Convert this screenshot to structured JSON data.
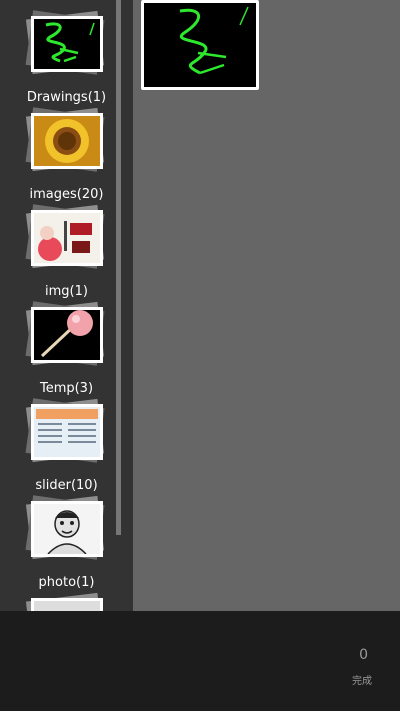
{
  "albums": [
    {
      "label": "Drawings(1)",
      "icon": "green-scribble-thumb"
    },
    {
      "label": "images(20)",
      "icon": "sunflower-thumb"
    },
    {
      "label": "img(1)",
      "icon": "zhou-nian-poster-thumb"
    },
    {
      "label": "Temp(3)",
      "icon": "lollipop-thumb"
    },
    {
      "label": "slider(10)",
      "icon": "document-thumb"
    },
    {
      "label": "photo(1)",
      "icon": "meme-face-thumb"
    }
  ],
  "footer": {
    "count": "0",
    "done_label": "完成"
  },
  "colors": {
    "sidebar_bg": "#333333",
    "content_bg": "#666666",
    "footer_bg": "#1c1c1c",
    "scribble": "#2ee82e"
  }
}
